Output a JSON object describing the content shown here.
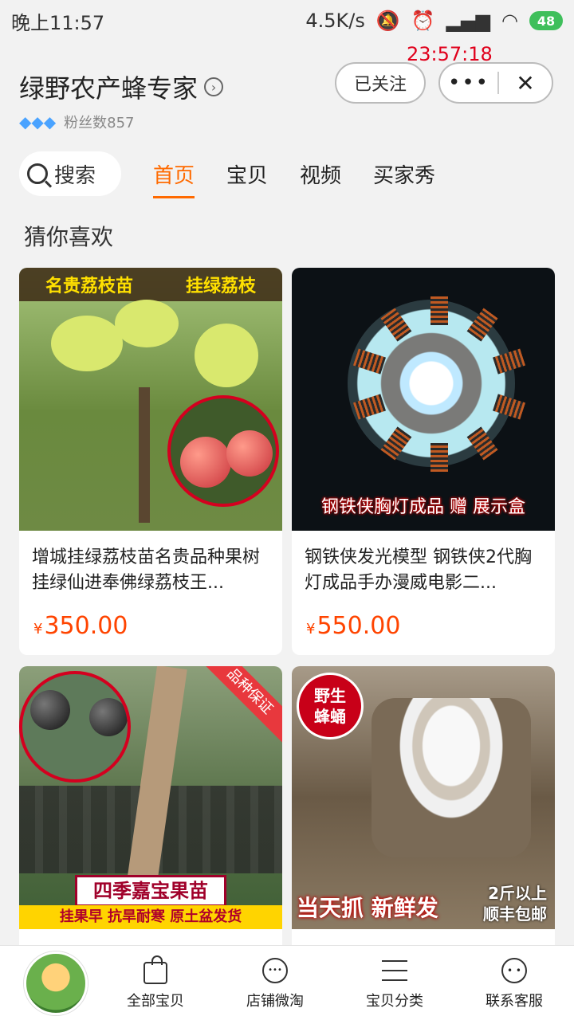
{
  "status_bar": {
    "time": "晚上11:57",
    "network_speed": "4.5K/s",
    "battery": "48"
  },
  "overlay_clock": "23:57:18",
  "header": {
    "shop_name": "绿野农产蜂专家",
    "fans": "粉丝数857",
    "follow_label": "已关注",
    "more_label": "•••",
    "close_label": "✕"
  },
  "tabs": {
    "search_label": "搜索",
    "items": [
      "首页",
      "宝贝",
      "视频",
      "买家秀"
    ],
    "active_index": 0
  },
  "section_title": "猜你喜欢",
  "products": [
    {
      "title": "增城挂绿荔枝苗名贵品种果树挂绿仙进奉佛绿荔枝王...",
      "currency": "¥",
      "price": "350.00",
      "image_text": [
        "名贵荔枝苗",
        "挂绿荔枝"
      ]
    },
    {
      "title": "钢铁侠发光模型 钢铁侠2代胸灯成品手办漫威电影二...",
      "currency": "¥",
      "price": "550.00",
      "image_text": [
        "钢铁侠胸灯成品 赠 展示盒"
      ]
    },
    {
      "title": "",
      "currency": "",
      "price": "",
      "image_text": [
        "品种保证",
        "四季嘉宝果苗",
        "挂果早  抗旱耐寒  原土盆发货"
      ]
    },
    {
      "title": "",
      "currency": "",
      "price": "",
      "image_text": [
        "野生",
        "蜂蛹",
        "当天抓 新鲜发",
        "2斤以上",
        "顺丰包邮"
      ]
    }
  ],
  "bottom_nav": {
    "items": [
      {
        "label": "全部宝贝",
        "icon": "bag-icon"
      },
      {
        "label": "店铺微淘",
        "icon": "broadcast-icon"
      },
      {
        "label": "宝贝分类",
        "icon": "list-icon"
      },
      {
        "label": "联系客服",
        "icon": "chat-icon"
      }
    ]
  },
  "colors": {
    "accent": "#ff6a00",
    "price": "#ff4400"
  }
}
